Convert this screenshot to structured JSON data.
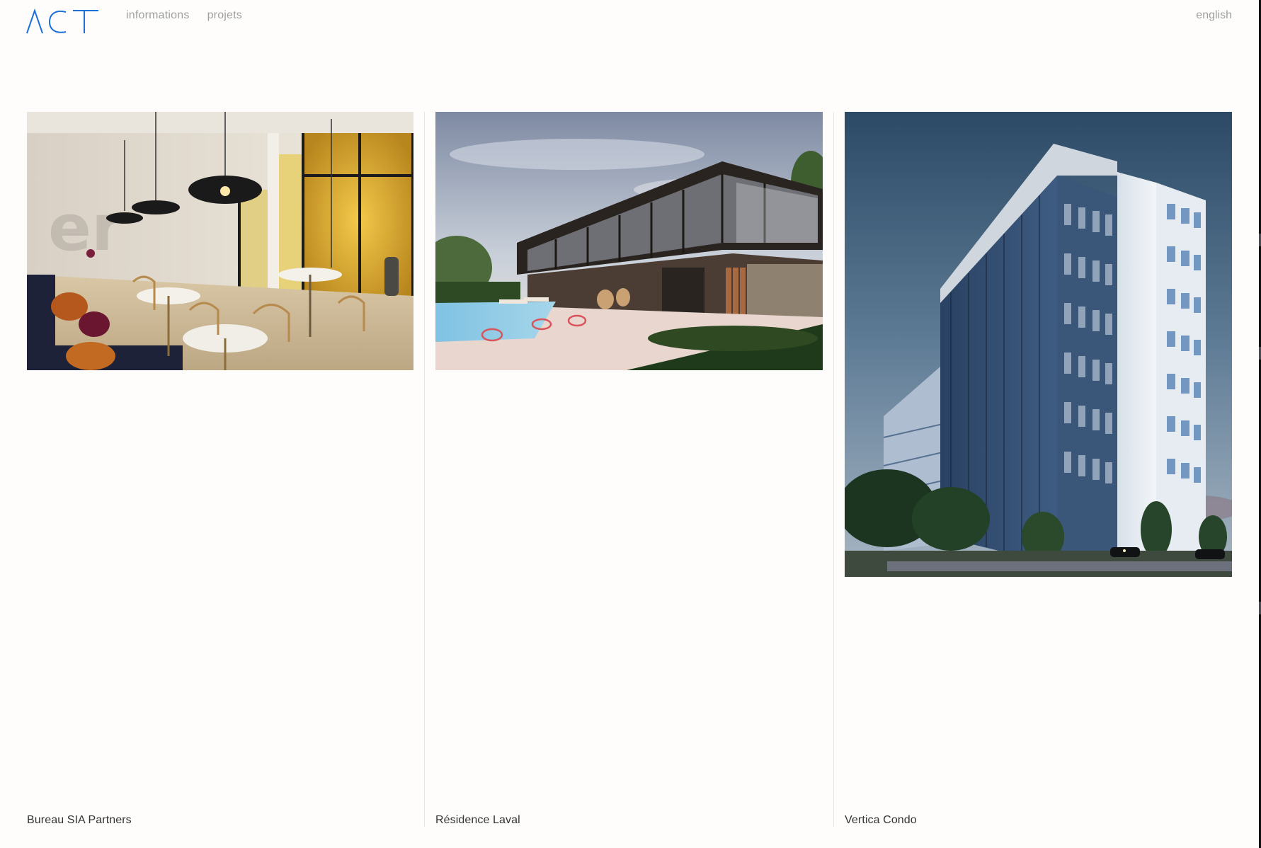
{
  "header": {
    "logo_text": "ACT",
    "nav": [
      {
        "label": "informations"
      },
      {
        "label": "projets"
      }
    ],
    "language_label": "english"
  },
  "projects": [
    {
      "title": "Bureau SIA Partners"
    },
    {
      "title": "Résidence Laval"
    },
    {
      "title": "Vertica Condo"
    }
  ],
  "colors": {
    "brand_blue": "#1f6fd6",
    "nav_grey": "#a0a0a0",
    "caption_text": "#333333"
  }
}
